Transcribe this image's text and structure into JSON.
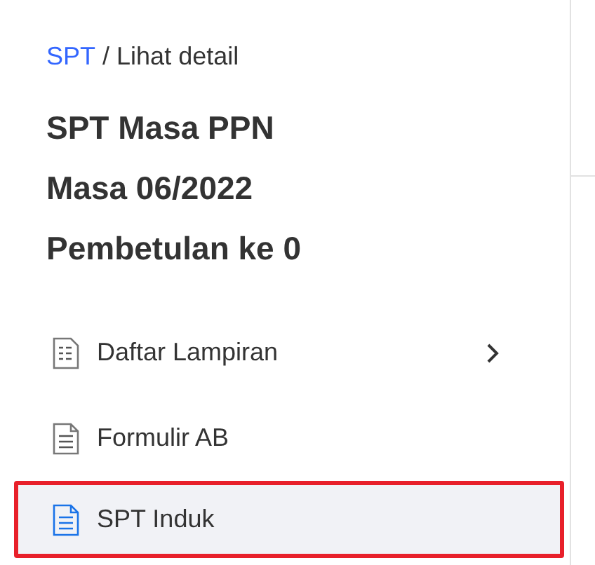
{
  "breadcrumb": {
    "link": "SPT",
    "separator": "/",
    "current": "Lihat detail"
  },
  "title_lines": [
    "SPT Masa PPN",
    "Masa 06/2022",
    "Pembetulan ke 0"
  ],
  "menu": [
    {
      "label": "Daftar Lampiran",
      "kind": "group",
      "selected": false,
      "highlighted": false
    },
    {
      "label": "Formulir AB",
      "kind": "page",
      "selected": false,
      "highlighted": false
    },
    {
      "label": "SPT Induk",
      "kind": "page",
      "selected": true,
      "highlighted": true
    }
  ]
}
